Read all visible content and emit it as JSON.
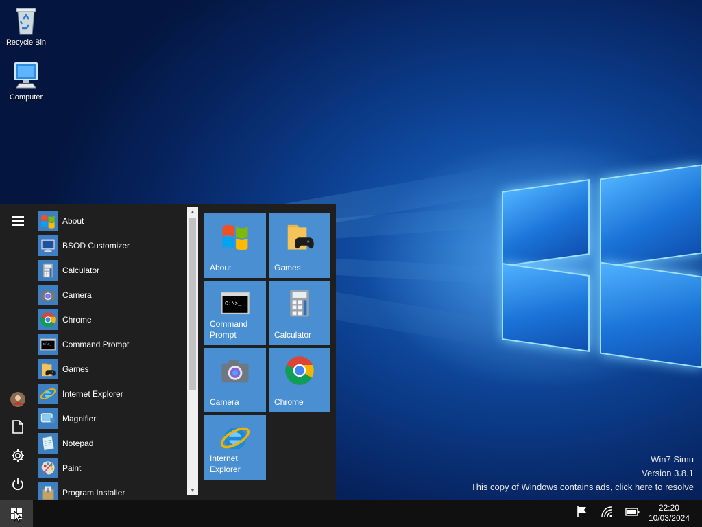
{
  "desktop": {
    "icons": [
      {
        "label": "Recycle Bin",
        "icon": "recycle-bin-icon"
      },
      {
        "label": "Computer",
        "icon": "computer-icon"
      }
    ]
  },
  "start_menu": {
    "rail": {
      "menu_icon": "hamburger-icon",
      "user_icon": "user-avatar-icon",
      "documents_icon": "document-icon",
      "settings_icon": "gear-icon",
      "power_icon": "power-icon"
    },
    "apps": [
      {
        "label": "About",
        "icon": "windows-flag-icon"
      },
      {
        "label": "BSOD Customizer",
        "icon": "monitor-icon"
      },
      {
        "label": "Calculator",
        "icon": "calculator-icon"
      },
      {
        "label": "Camera",
        "icon": "camera-icon"
      },
      {
        "label": "Chrome",
        "icon": "chrome-icon"
      },
      {
        "label": "Command Prompt",
        "icon": "terminal-icon"
      },
      {
        "label": "Games",
        "icon": "games-folder-icon"
      },
      {
        "label": "Internet Explorer",
        "icon": "internet-explorer-icon"
      },
      {
        "label": "Magnifier",
        "icon": "magnifier-icon"
      },
      {
        "label": "Notepad",
        "icon": "notepad-icon"
      },
      {
        "label": "Paint",
        "icon": "paint-palette-icon"
      },
      {
        "label": "Program Installer",
        "icon": "installer-icon"
      }
    ],
    "tiles": [
      {
        "label": "About",
        "icon": "windows-flag-icon"
      },
      {
        "label": "Games",
        "icon": "games-folder-icon"
      },
      {
        "label": "Command Prompt",
        "icon": "terminal-icon"
      },
      {
        "label": "Calculator",
        "icon": "calculator-icon"
      },
      {
        "label": "Camera",
        "icon": "camera-icon"
      },
      {
        "label": "Chrome",
        "icon": "chrome-icon"
      },
      {
        "label": "Internet Explorer",
        "icon": "internet-explorer-icon"
      }
    ]
  },
  "watermark": {
    "line1": "Win7 Simu",
    "line2": "Version 3.8.1",
    "line3": "This copy of Windows contains ads, click here to resolve"
  },
  "taskbar": {
    "start_icon": "windows-logo-icon",
    "tray_icons": [
      "flag-icon",
      "wifi-icon",
      "battery-icon"
    ],
    "time": "22:20",
    "date": "10/03/2024"
  },
  "colors": {
    "tile": "#4a8fd1",
    "menu_bg": "#1f1f1f",
    "taskbar_bg": "#101010",
    "accent": "#3e7fc2"
  }
}
